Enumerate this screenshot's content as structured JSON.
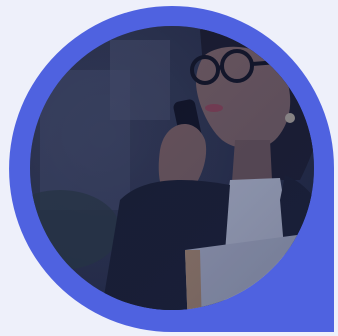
{
  "colors": {
    "page_background": "#eef0fa",
    "frame_blue": "#4f62e0",
    "photo_overlay": "#1a2240"
  },
  "image": {
    "subject": "woman-on-phone-photo",
    "frame_shape": "circle-with-square-bottom-right-corner"
  }
}
